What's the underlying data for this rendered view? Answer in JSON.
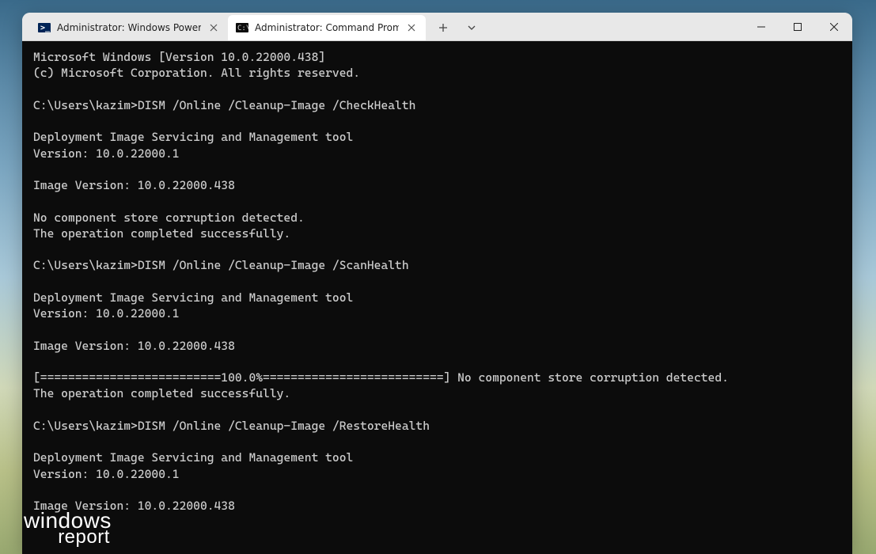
{
  "tabs": [
    {
      "label": "Administrator: Windows PowerS",
      "icon": "powershell"
    },
    {
      "label": "Administrator: Command Promp",
      "icon": "cmd"
    }
  ],
  "active_tab": 1,
  "terminal_lines": [
    "Microsoft Windows [Version 10.0.22000.438]",
    "(c) Microsoft Corporation. All rights reserved.",
    "",
    "C:\\Users\\kazim>DISM /Online /Cleanup-Image /CheckHealth",
    "",
    "Deployment Image Servicing and Management tool",
    "Version: 10.0.22000.1",
    "",
    "Image Version: 10.0.22000.438",
    "",
    "No component store corruption detected.",
    "The operation completed successfully.",
    "",
    "C:\\Users\\kazim>DISM /Online /Cleanup-Image /ScanHealth",
    "",
    "Deployment Image Servicing and Management tool",
    "Version: 10.0.22000.1",
    "",
    "Image Version: 10.0.22000.438",
    "",
    "[==========================100.0%==========================] No component store corruption detected.",
    "The operation completed successfully.",
    "",
    "C:\\Users\\kazim>DISM /Online /Cleanup-Image /RestoreHealth",
    "",
    "Deployment Image Servicing and Management tool",
    "Version: 10.0.22000.1",
    "",
    "Image Version: 10.0.22000.438"
  ],
  "watermark": {
    "line1": "windows",
    "line2": "report"
  }
}
